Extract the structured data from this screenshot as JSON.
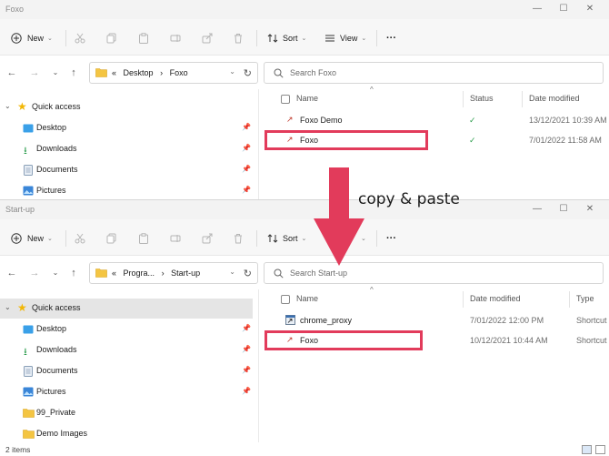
{
  "windows": {
    "top": {
      "title": "Foxo",
      "toolbar": {
        "new_label": "New",
        "sort_label": "Sort",
        "view_label": "View",
        "more_label": "···"
      },
      "address": {
        "prefix": "«",
        "crumbs": [
          "Desktop",
          "Foxo"
        ],
        "sep": "›"
      },
      "search_placeholder": "Search Foxo",
      "nav_pane": [
        {
          "label": "Quick access",
          "icon": "star-icon"
        },
        {
          "label": "Desktop",
          "icon": "desktop-folder-icon",
          "pinned": true
        },
        {
          "label": "Downloads",
          "icon": "download-arrow-icon",
          "pinned": true
        },
        {
          "label": "Documents",
          "icon": "documents-icon",
          "pinned": true
        },
        {
          "label": "Pictures",
          "icon": "pictures-icon",
          "pinned": true
        }
      ],
      "columns": [
        "Name",
        "Status",
        "Date modified"
      ],
      "rows": [
        {
          "name": "Foxo Demo",
          "status": "✓",
          "date": "13/12/2021 10:39 AM"
        },
        {
          "name": "Foxo",
          "status": "✓",
          "date": "7/01/2022 11:58 AM"
        }
      ]
    },
    "bottom": {
      "title": "Start-up",
      "toolbar": {
        "new_label": "New",
        "sort_label": "Sort",
        "more_label": "···"
      },
      "address": {
        "prefix": "«",
        "crumbs": [
          "Progra...",
          "Start-up"
        ],
        "sep": "›"
      },
      "search_placeholder": "Search Start-up",
      "nav_pane": [
        {
          "label": "Quick access",
          "icon": "star-icon"
        },
        {
          "label": "Desktop",
          "icon": "desktop-folder-icon",
          "pinned": true
        },
        {
          "label": "Downloads",
          "icon": "download-arrow-icon",
          "pinned": true
        },
        {
          "label": "Documents",
          "icon": "documents-icon",
          "pinned": true
        },
        {
          "label": "Pictures",
          "icon": "pictures-icon",
          "pinned": true
        },
        {
          "label": "99_Private",
          "icon": "folder-icon"
        },
        {
          "label": "Demo Images",
          "icon": "folder-icon"
        }
      ],
      "columns": [
        "Name",
        "Date modified",
        "Type"
      ],
      "rows": [
        {
          "name": "chrome_proxy",
          "date": "7/01/2022 12:00 PM",
          "type": "Shortcut"
        },
        {
          "name": "Foxo",
          "date": "10/12/2021 10:44 AM",
          "type": "Shortcut"
        }
      ],
      "status_count": "2 items"
    }
  },
  "annotation": {
    "text": "copy & paste"
  },
  "colors": {
    "highlight": "#e23b5b",
    "check": "#2e9e4f",
    "folder": "#f4c542",
    "accent": "#0067c0"
  }
}
